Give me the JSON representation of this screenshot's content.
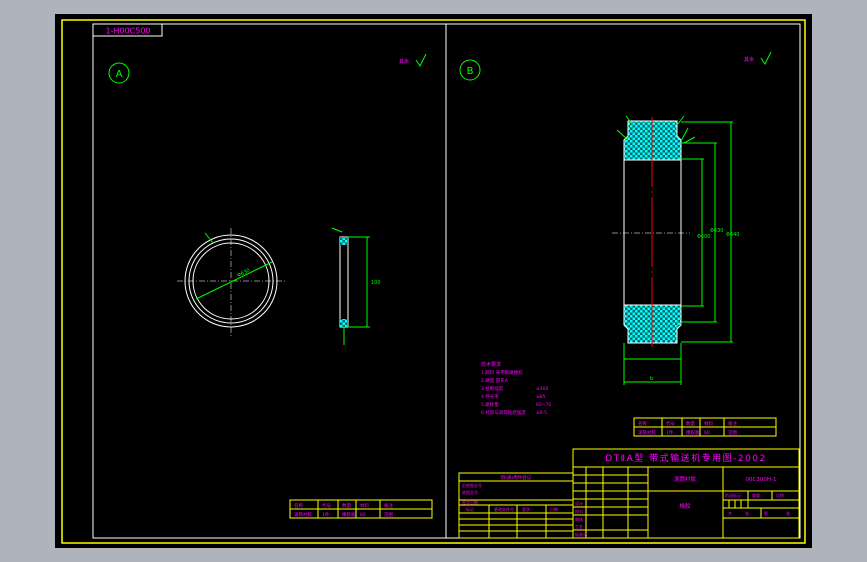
{
  "drawing_number_label": "1-H00C500",
  "view_labels": {
    "left": "A",
    "right": "B"
  },
  "roughness_note_left": "其余",
  "roughness_note_right": "其余",
  "title_block": {
    "series_title": "DTⅡA型 带式输送机专用图-2002",
    "part_name": "滚筒衬胶",
    "drawing_code": "00C300H-1",
    "material": "橡胶",
    "stage_label": "阶段标记",
    "weight_label": "重量",
    "scale_label": "比例",
    "sheet_total": "共",
    "sheet_no": "第",
    "sheet_count_a": "张",
    "sheet_count_b": "张"
  },
  "technical_requirements": {
    "title": "技术要求",
    "lines": [
      "1.胶料 采用耐磨橡胶",
      "2.硬度 邵氏A",
      "3.扯断强度",
      "4.伸长率",
      "5.磨耗量",
      "6.衬胶与滚筒粘结强度"
    ],
    "values": [
      "",
      "",
      "≥300",
      "≥85",
      "60~70",
      "≥0.5"
    ]
  },
  "change_table": {
    "header": "借(通)用件登记",
    "rows": [
      "旧底图总号",
      "底图总号",
      "签字日期"
    ],
    "columns": [
      "标记",
      "处数",
      "更改文件号",
      "签字",
      "日期"
    ],
    "left_labels": [
      "设计",
      "校对",
      "审核",
      "工艺",
      "标准化"
    ]
  },
  "small_table_left": {
    "row1": [
      "名称",
      "代号",
      "数量",
      "材料",
      "备注"
    ],
    "row2": [
      "滚筒衬胶",
      "1件",
      "橡胶板",
      "60",
      "见图"
    ]
  },
  "small_table_right": {
    "row1": [
      "名称",
      "代号",
      "数量",
      "材料",
      "备注"
    ],
    "row2": [
      "滚筒衬胶",
      "1件",
      "橡胶板",
      "60",
      "见图"
    ]
  },
  "dimensions": {
    "left_diameter": "Φ630",
    "left_height": "100",
    "right_d1": "Φ500",
    "right_d2": "Φ630",
    "right_d3": "Φ640",
    "right_width": "b"
  },
  "colors": {
    "background": "#000000",
    "frame": "#ffff00",
    "inner_frame": "#ffffff",
    "text": "#ff00ff",
    "dimension": "#00ff00",
    "hatch": "#00ffff",
    "centerline": "#ff0000",
    "outer_gray": "#aeb3bc"
  }
}
